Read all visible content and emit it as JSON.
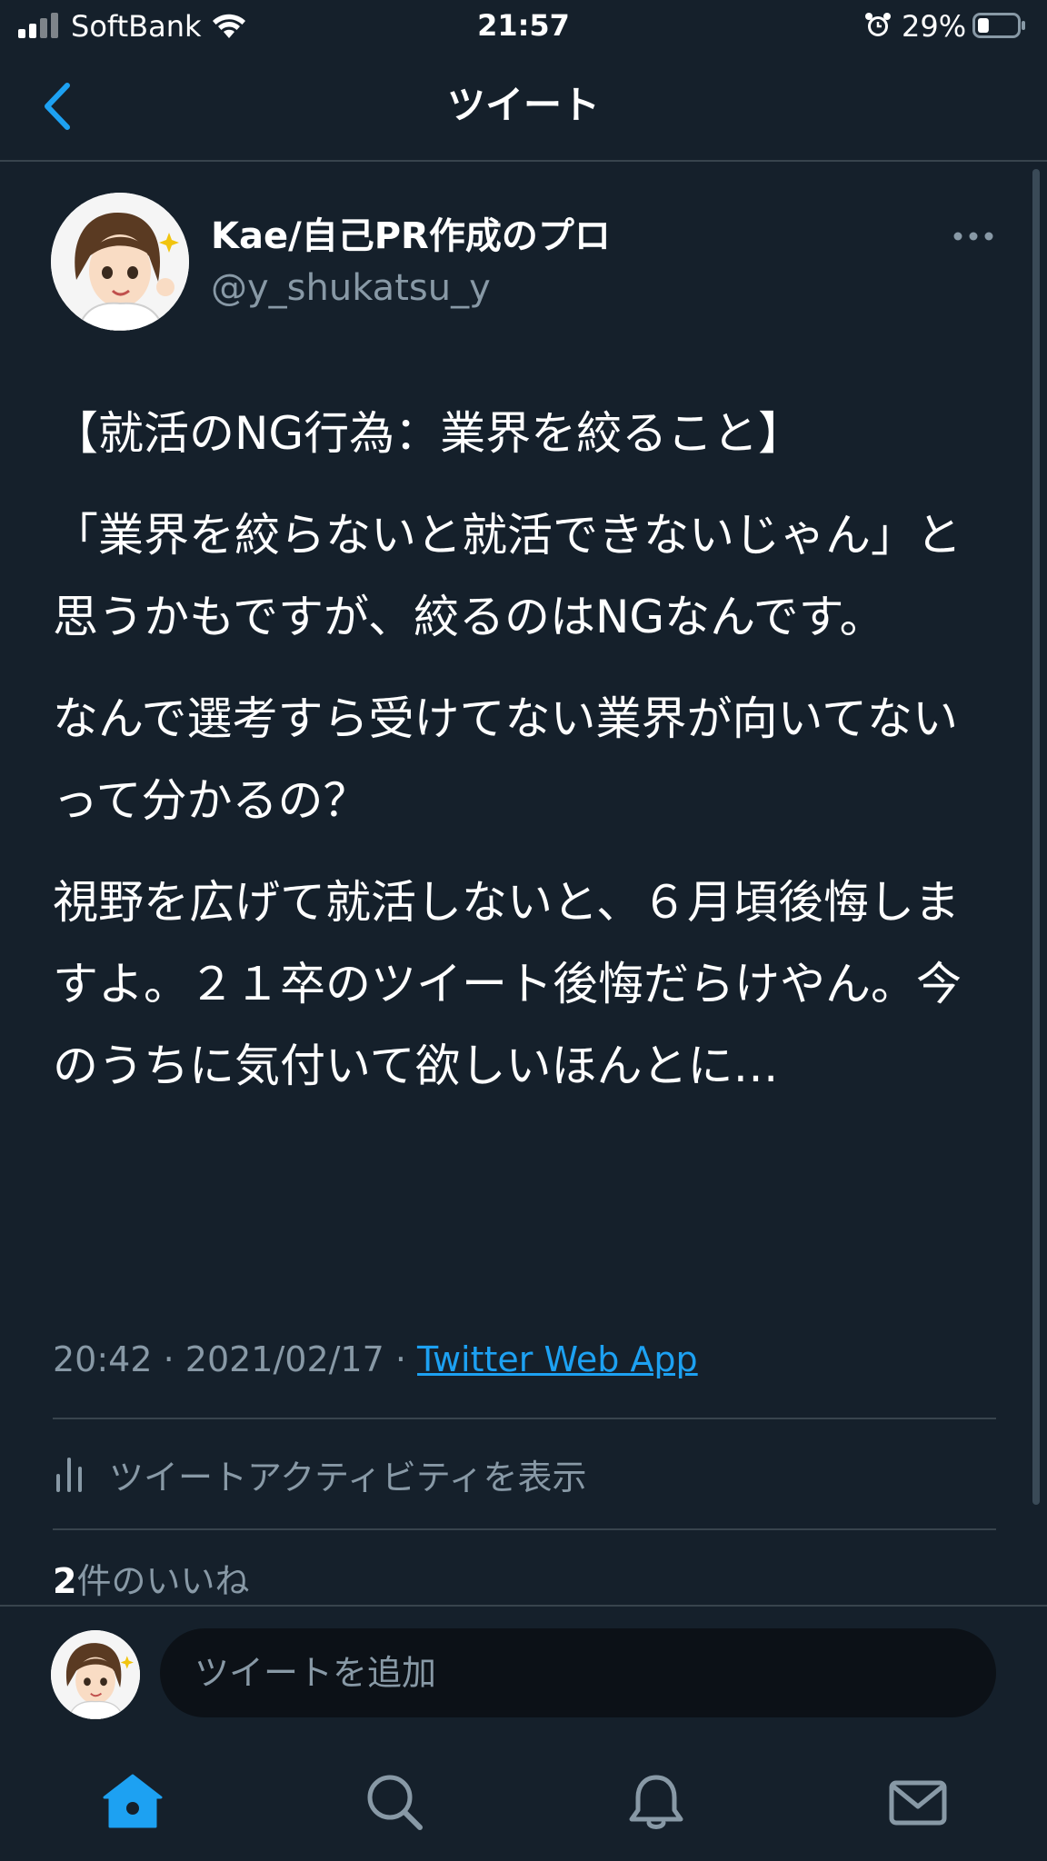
{
  "status_bar": {
    "carrier": "SoftBank",
    "time": "21:57",
    "battery_percent": "29%",
    "battery_level": 0.29
  },
  "header": {
    "title": "ツイート",
    "back_icon": "chevron-left-icon"
  },
  "author": {
    "display_name": "Kae/自己PR作成のプロ",
    "handle": "@y_shukatsu_y"
  },
  "tweet": {
    "paragraphs": [
      "【就活のNG行為：業界を絞ること】",
      "「業界を絞らないと就活できないじゃん」と思うかもですが、絞るのはNGなんです。",
      "なんで選考すら受けてない業界が向いてないって分かるの？",
      "視野を広げて就活しないと、６月頃後悔しますよ。２１卒のツイート後悔だらけやん。今のうちに気付いて欲しいほんとに…"
    ],
    "time": "20:42",
    "date": "2021/02/17",
    "separator": " · ",
    "source": "Twitter Web App"
  },
  "activity": {
    "label": "ツイートアクティビティを表示",
    "icon": "bar-chart-icon"
  },
  "likes": {
    "count": "2",
    "label": "件のいいね"
  },
  "reply": {
    "placeholder": "ツイートを追加"
  },
  "tab_bar": {
    "items": [
      {
        "name": "home",
        "icon": "home-icon",
        "active": true
      },
      {
        "name": "search",
        "icon": "search-icon",
        "active": false
      },
      {
        "name": "notifications",
        "icon": "bell-icon",
        "active": false
      },
      {
        "name": "messages",
        "icon": "mail-icon",
        "active": false
      }
    ]
  },
  "colors": {
    "background": "#15202b",
    "accent": "#1da1f2",
    "secondary_text": "#8899a6",
    "divider": "#38444d"
  }
}
